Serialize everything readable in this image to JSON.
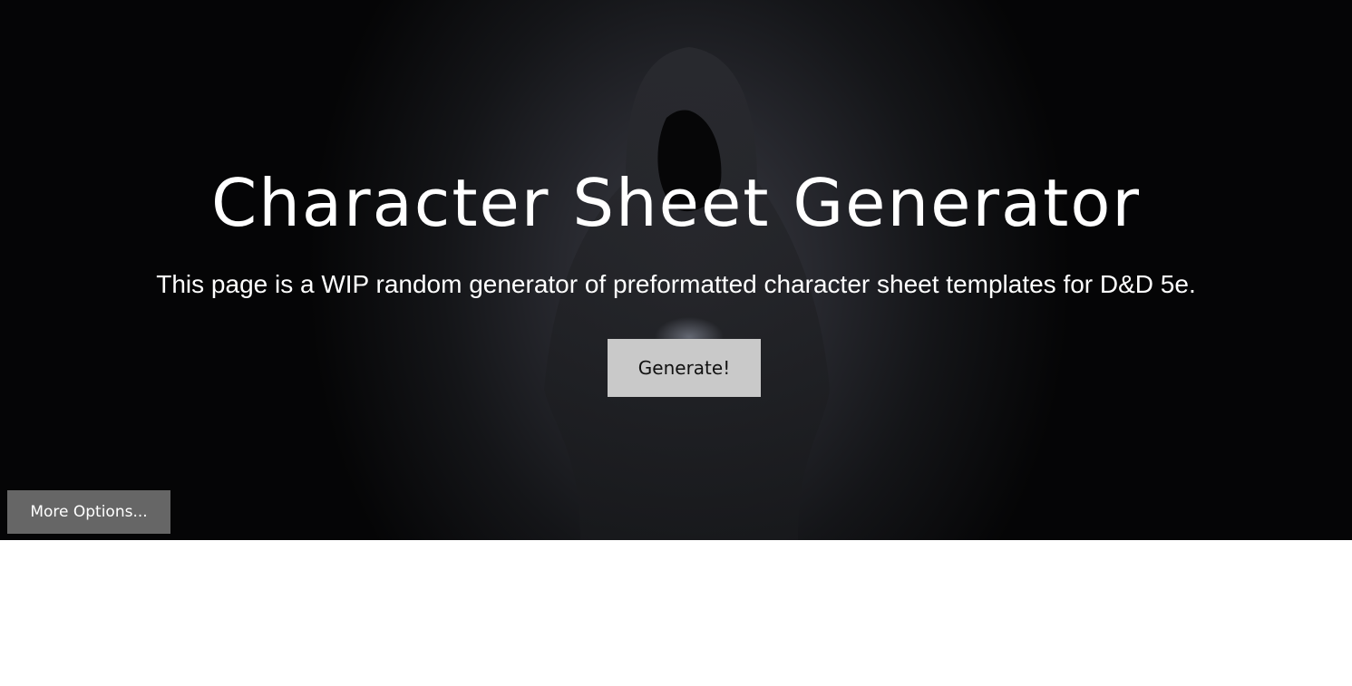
{
  "hero": {
    "title": "Character Sheet Generator",
    "subtitle": "This page is a WIP random generator of preformatted character sheet templates for D&D 5e.",
    "generate_label": "Generate!",
    "more_options_label": "More Options..."
  },
  "colors": {
    "hero_background": "#1c1d22",
    "generate_button_bg": "#c9c9c9",
    "more_options_button_bg": "#666666",
    "text": "#ffffff"
  }
}
